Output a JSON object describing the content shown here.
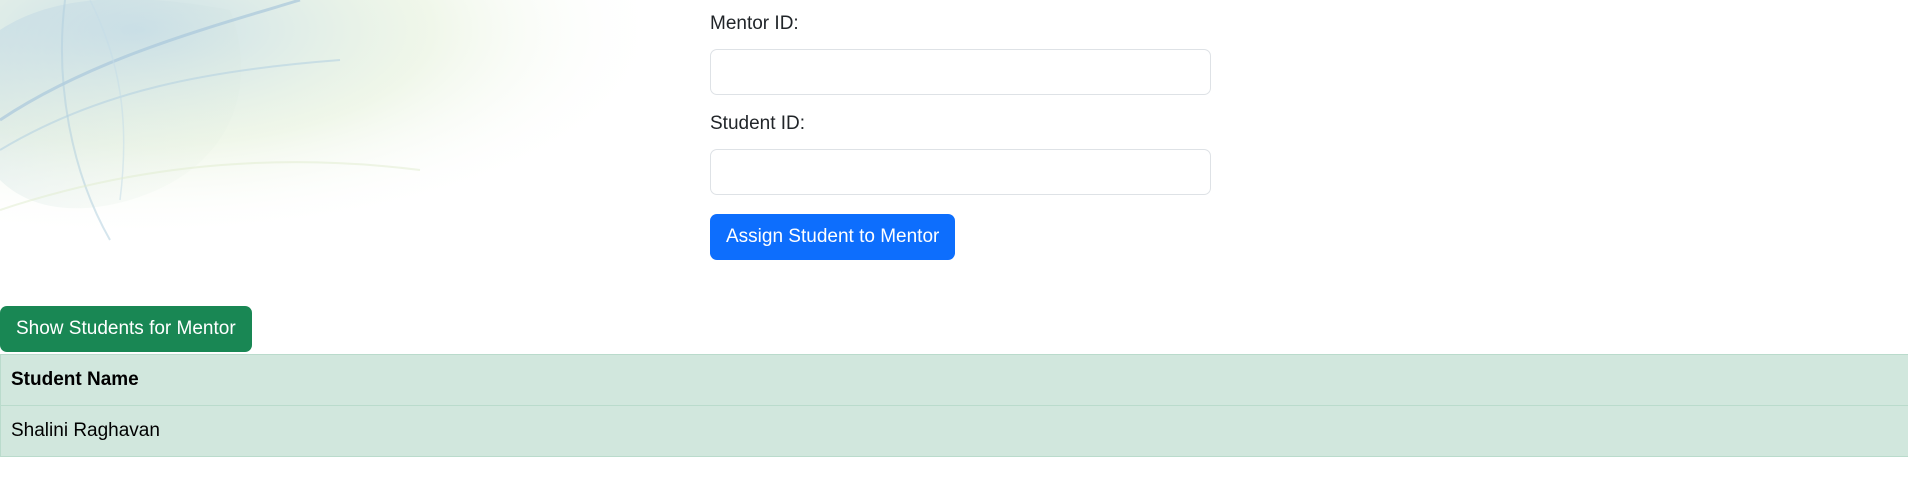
{
  "assign_form": {
    "mentor_label": "Mentor ID:",
    "mentor_value": "",
    "student_label": "Student ID:",
    "student_value": "",
    "submit_label": "Assign Student to Mentor"
  },
  "show_students_button": "Show Students for Mentor",
  "students_table": {
    "header": "Student Name",
    "rows": [
      "Shalini Raghavan"
    ]
  },
  "colors": {
    "primary": "#0d6efd",
    "success": "#198754",
    "table_bg": "#d1e7dd"
  }
}
